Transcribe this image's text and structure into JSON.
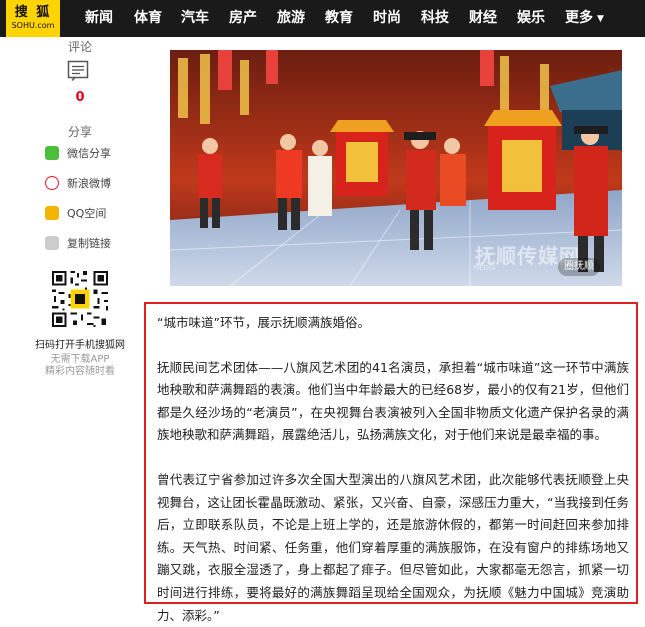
{
  "header": {
    "logo_text": "搜 狐",
    "logo_sub": "SOHU.com",
    "nav": [
      "新闻",
      "体育",
      "汽车",
      "房产",
      "旅游",
      "教育",
      "时尚",
      "科技",
      "财经",
      "娱乐"
    ],
    "more_label": "更多"
  },
  "sidebar": {
    "comment_title": "评论",
    "comment_count": "0",
    "share_title": "分享",
    "share_items": [
      {
        "label": "微信分享",
        "icon": "wechat-icon",
        "color": "#4cbf3a"
      },
      {
        "label": "新浪微博",
        "icon": "weibo-icon",
        "color": "#e6162d"
      },
      {
        "label": "QQ空间",
        "icon": "qzone-icon",
        "color": "#f5b400"
      },
      {
        "label": "复制链接",
        "icon": "link-icon",
        "color": "#bbbbbb"
      }
    ],
    "qr_caption": "扫码打开手机搜狐网",
    "qr_sub1": "无需下载APP",
    "qr_sub2": "精彩内容随时看"
  },
  "hero_image": {
    "watermark": "抚顺传媒网",
    "watermark_sub": "MEDIA",
    "badge": "圈抚顺"
  },
  "article": {
    "paragraphs": [
      "“城市味道”环节，展示抚顺满族婚俗。",
      "抚顺民间艺术团体——八旗风艺术团的41名演员，承担着“城市味道”这一环节中满族地秧歌和萨满舞蹈的表演。他们当中年龄最大的已经68岁，最小的仅有21岁，但他们都是久经沙场的“老演员”，在央视舞台表演被列入全国非物质文化遗产保护名录的满族地秧歌和萨满舞蹈，展露绝活儿，弘扬满族文化，对于他们来说是最幸福的事。",
      "曾代表辽宁省参加过许多次全国大型演出的八旗风艺术团，此次能够代表抚顺登上央视舞台，这让团长霍晶既激动、紧张，又兴奋、自豪，深感压力重大，“当我接到任务后，立即联系队员，不论是上班上学的，还是旅游休假的，都第一时间赶回来参加排练。天气热、时间紧、任务重，他们穿着厚重的满族服饰，在没有窗户的排练场地又蹦又跳，衣服全湿透了，身上都起了痱子。但尽管如此，大家都毫无怨言，抓紧一切时间进行排练，要将最好的满族舞蹈呈现给全国观众，为抚顺《魅力中国城》竞演助力、添彩。”"
    ]
  },
  "colors": {
    "nav_bg": "#1a1a1a",
    "logo_bg": "#ffd400",
    "accent_red": "#e02020"
  }
}
